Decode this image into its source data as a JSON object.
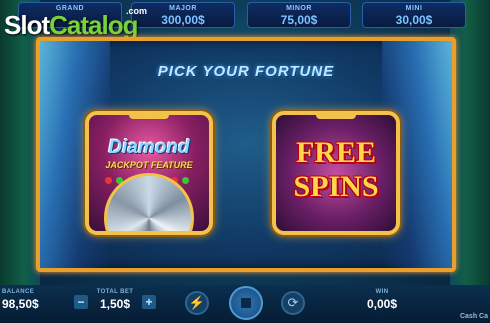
{
  "logo": {
    "slot": "Slot",
    "catalog": "Catalog",
    "com": ".com"
  },
  "jackpots": [
    {
      "label": "GRAND",
      "value": ""
    },
    {
      "label": "MAJOR",
      "value": "300,00$"
    },
    {
      "label": "MINOR",
      "value": "75,00$"
    },
    {
      "label": "MINI",
      "value": "30,00$"
    }
  ],
  "bonus": {
    "title": "PICK YOUR FORTUNE",
    "diamond_title": "Diamond",
    "diamond_subtitle": "JACKPOT FEATURE",
    "spins_line1": "FREE",
    "spins_line2": "SPINS"
  },
  "bottom": {
    "balance_label": "BALANCE",
    "balance_value": "98,50$",
    "bet_label": "TOTAL BET",
    "bet_value": "1,50$",
    "win_label": "WIN",
    "win_value": "0,00$",
    "brand": "Cash Ca",
    "minus": "−",
    "plus": "+",
    "turbo_icon": "⚡",
    "auto_icon": "⟳"
  },
  "colors": {
    "frame": "#e8a02a",
    "accent": "#ffd84a",
    "free_spins_outline": "#b80010"
  },
  "icons": [
    "lightning-icon",
    "stop-icon",
    "autoplay-icon"
  ]
}
